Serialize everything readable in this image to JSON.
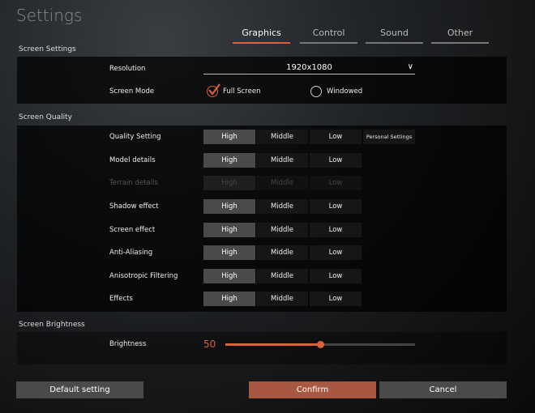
{
  "title": "Settings",
  "tabs": [
    {
      "label": "Graphics",
      "active": true
    },
    {
      "label": "Control"
    },
    {
      "label": "Sound"
    },
    {
      "label": "Other"
    }
  ],
  "screen_settings": {
    "heading": "Screen Settings",
    "resolution_label": "Resolution",
    "resolution_value": "1920x1080",
    "mode_label": "Screen Mode",
    "modes": [
      "Full Screen",
      "Windowed"
    ],
    "selected_mode": "Full Screen"
  },
  "screen_quality": {
    "heading": "Screen Quality",
    "options": [
      "High",
      "Middle",
      "Low"
    ],
    "personal": "Personal Settings",
    "rows": [
      {
        "label": "Quality Setting",
        "value": "High"
      },
      {
        "label": "Model details",
        "value": "High"
      },
      {
        "label": "Terrain details",
        "value": "High",
        "disabled": true
      },
      {
        "label": "Shadow effect",
        "value": "High"
      },
      {
        "label": "Screen effect",
        "value": "High"
      },
      {
        "label": "Anti-Aliasing",
        "value": "High"
      },
      {
        "label": "Anisotropic Filtering",
        "value": "High"
      },
      {
        "label": "Effects",
        "value": "High"
      }
    ]
  },
  "brightness": {
    "heading": "Screen Brightness",
    "label": "Brightness",
    "value": "50",
    "percent": 50
  },
  "buttons": {
    "default": "Default setting",
    "confirm": "Confirm",
    "cancel": "Cancel"
  },
  "colors": {
    "accent": "#d8633e",
    "confirm": "#a85840"
  }
}
